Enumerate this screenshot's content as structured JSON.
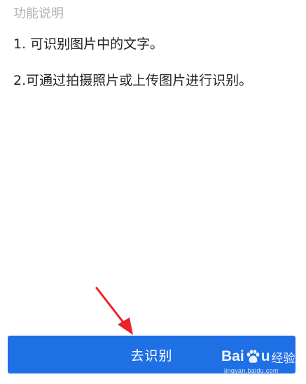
{
  "feature_section": {
    "title": "功能说明",
    "lines": [
      "1. 可识别图片中的文字。",
      "2.可通过拍摄照片或上传图片进行识别。"
    ]
  },
  "action_button": {
    "label": "去识别"
  },
  "annotation": {
    "arrow_color": "#e8232a"
  },
  "watermark": {
    "logo_left": "Bai",
    "logo_right": "u",
    "logo_suffix": "经验",
    "url": "jingyan.baidu.com"
  },
  "colors": {
    "primary": "#1f6fe5",
    "text": "#222222",
    "muted": "#b3b3b3"
  }
}
